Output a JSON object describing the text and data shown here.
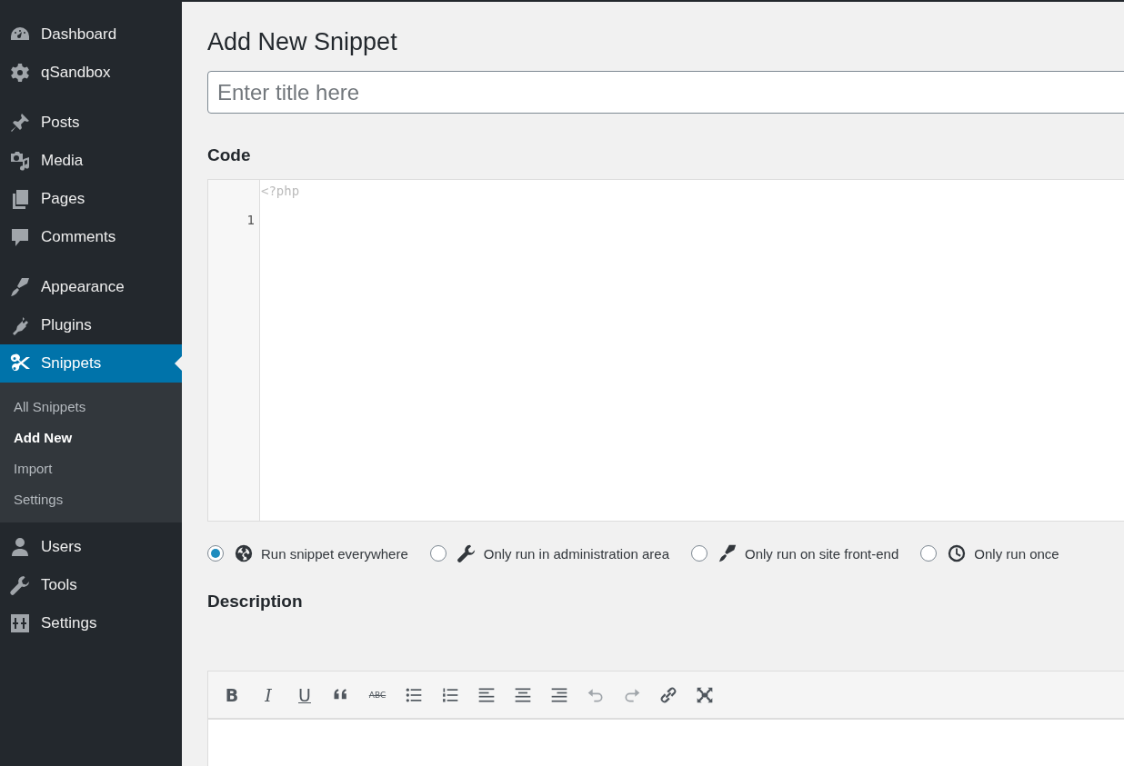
{
  "sidebar": {
    "groups": [
      [
        {
          "label": "Dashboard",
          "selected": false
        },
        {
          "label": "qSandbox",
          "selected": false
        }
      ],
      [
        {
          "label": "Posts",
          "selected": false
        },
        {
          "label": "Media",
          "selected": false
        },
        {
          "label": "Pages",
          "selected": false
        },
        {
          "label": "Comments",
          "selected": false
        }
      ],
      [
        {
          "label": "Appearance",
          "selected": false
        },
        {
          "label": "Plugins",
          "selected": false
        },
        {
          "label": "Snippets",
          "selected": true,
          "children": [
            {
              "label": "All Snippets",
              "selected": false
            },
            {
              "label": "Add New",
              "selected": true
            },
            {
              "label": "Import",
              "selected": false
            },
            {
              "label": "Settings",
              "selected": false
            }
          ]
        }
      ],
      [
        {
          "label": "Users",
          "selected": false
        },
        {
          "label": "Tools",
          "selected": false
        },
        {
          "label": "Settings",
          "selected": false
        }
      ]
    ]
  },
  "page_title": "Add New Snippet",
  "title_field": {
    "placeholder": "Enter title here"
  },
  "code": {
    "label": "Code",
    "opening_tag": "<?php",
    "line_numbers": [
      "1"
    ]
  },
  "scope_options": [
    {
      "label": "Run snippet everywhere",
      "selected": true
    },
    {
      "label": "Only run in administration area",
      "selected": false
    },
    {
      "label": "Only run on site front-end",
      "selected": false
    },
    {
      "label": "Only run once",
      "selected": false
    }
  ],
  "description": {
    "label": "Description",
    "toolbar": [
      {
        "kind": "bold",
        "glyph": "B",
        "disabled": false
      },
      {
        "kind": "italic",
        "glyph": "I",
        "disabled": false
      },
      {
        "kind": "underline",
        "glyph": "U",
        "disabled": false
      },
      {
        "kind": "quote",
        "disabled": false
      },
      {
        "kind": "strike",
        "glyph": "ABC",
        "disabled": false
      },
      {
        "kind": "bullets",
        "disabled": false
      },
      {
        "kind": "numbers",
        "disabled": false
      },
      {
        "kind": "align-left",
        "disabled": false
      },
      {
        "kind": "align-center",
        "disabled": false
      },
      {
        "kind": "align-right",
        "disabled": false
      },
      {
        "kind": "undo",
        "disabled": true
      },
      {
        "kind": "redo",
        "disabled": true
      },
      {
        "kind": "link",
        "disabled": false
      },
      {
        "kind": "fullscreen",
        "disabled": false
      }
    ]
  }
}
